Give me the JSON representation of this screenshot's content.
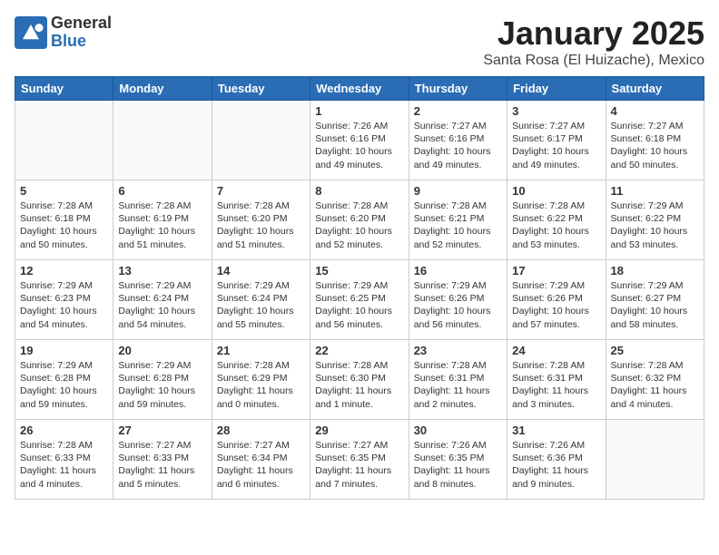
{
  "header": {
    "logo_general": "General",
    "logo_blue": "Blue",
    "month_title": "January 2025",
    "subtitle": "Santa Rosa (El Huizache), Mexico"
  },
  "days_of_week": [
    "Sunday",
    "Monday",
    "Tuesday",
    "Wednesday",
    "Thursday",
    "Friday",
    "Saturday"
  ],
  "weeks": [
    [
      {
        "day": "",
        "content": ""
      },
      {
        "day": "",
        "content": ""
      },
      {
        "day": "",
        "content": ""
      },
      {
        "day": "1",
        "content": "Sunrise: 7:26 AM\nSunset: 6:16 PM\nDaylight: 10 hours\nand 49 minutes."
      },
      {
        "day": "2",
        "content": "Sunrise: 7:27 AM\nSunset: 6:16 PM\nDaylight: 10 hours\nand 49 minutes."
      },
      {
        "day": "3",
        "content": "Sunrise: 7:27 AM\nSunset: 6:17 PM\nDaylight: 10 hours\nand 49 minutes."
      },
      {
        "day": "4",
        "content": "Sunrise: 7:27 AM\nSunset: 6:18 PM\nDaylight: 10 hours\nand 50 minutes."
      }
    ],
    [
      {
        "day": "5",
        "content": "Sunrise: 7:28 AM\nSunset: 6:18 PM\nDaylight: 10 hours\nand 50 minutes."
      },
      {
        "day": "6",
        "content": "Sunrise: 7:28 AM\nSunset: 6:19 PM\nDaylight: 10 hours\nand 51 minutes."
      },
      {
        "day": "7",
        "content": "Sunrise: 7:28 AM\nSunset: 6:20 PM\nDaylight: 10 hours\nand 51 minutes."
      },
      {
        "day": "8",
        "content": "Sunrise: 7:28 AM\nSunset: 6:20 PM\nDaylight: 10 hours\nand 52 minutes."
      },
      {
        "day": "9",
        "content": "Sunrise: 7:28 AM\nSunset: 6:21 PM\nDaylight: 10 hours\nand 52 minutes."
      },
      {
        "day": "10",
        "content": "Sunrise: 7:28 AM\nSunset: 6:22 PM\nDaylight: 10 hours\nand 53 minutes."
      },
      {
        "day": "11",
        "content": "Sunrise: 7:29 AM\nSunset: 6:22 PM\nDaylight: 10 hours\nand 53 minutes."
      }
    ],
    [
      {
        "day": "12",
        "content": "Sunrise: 7:29 AM\nSunset: 6:23 PM\nDaylight: 10 hours\nand 54 minutes."
      },
      {
        "day": "13",
        "content": "Sunrise: 7:29 AM\nSunset: 6:24 PM\nDaylight: 10 hours\nand 54 minutes."
      },
      {
        "day": "14",
        "content": "Sunrise: 7:29 AM\nSunset: 6:24 PM\nDaylight: 10 hours\nand 55 minutes."
      },
      {
        "day": "15",
        "content": "Sunrise: 7:29 AM\nSunset: 6:25 PM\nDaylight: 10 hours\nand 56 minutes."
      },
      {
        "day": "16",
        "content": "Sunrise: 7:29 AM\nSunset: 6:26 PM\nDaylight: 10 hours\nand 56 minutes."
      },
      {
        "day": "17",
        "content": "Sunrise: 7:29 AM\nSunset: 6:26 PM\nDaylight: 10 hours\nand 57 minutes."
      },
      {
        "day": "18",
        "content": "Sunrise: 7:29 AM\nSunset: 6:27 PM\nDaylight: 10 hours\nand 58 minutes."
      }
    ],
    [
      {
        "day": "19",
        "content": "Sunrise: 7:29 AM\nSunset: 6:28 PM\nDaylight: 10 hours\nand 59 minutes."
      },
      {
        "day": "20",
        "content": "Sunrise: 7:29 AM\nSunset: 6:28 PM\nDaylight: 10 hours\nand 59 minutes."
      },
      {
        "day": "21",
        "content": "Sunrise: 7:28 AM\nSunset: 6:29 PM\nDaylight: 11 hours\nand 0 minutes."
      },
      {
        "day": "22",
        "content": "Sunrise: 7:28 AM\nSunset: 6:30 PM\nDaylight: 11 hours\nand 1 minute."
      },
      {
        "day": "23",
        "content": "Sunrise: 7:28 AM\nSunset: 6:31 PM\nDaylight: 11 hours\nand 2 minutes."
      },
      {
        "day": "24",
        "content": "Sunrise: 7:28 AM\nSunset: 6:31 PM\nDaylight: 11 hours\nand 3 minutes."
      },
      {
        "day": "25",
        "content": "Sunrise: 7:28 AM\nSunset: 6:32 PM\nDaylight: 11 hours\nand 4 minutes."
      }
    ],
    [
      {
        "day": "26",
        "content": "Sunrise: 7:28 AM\nSunset: 6:33 PM\nDaylight: 11 hours\nand 4 minutes."
      },
      {
        "day": "27",
        "content": "Sunrise: 7:27 AM\nSunset: 6:33 PM\nDaylight: 11 hours\nand 5 minutes."
      },
      {
        "day": "28",
        "content": "Sunrise: 7:27 AM\nSunset: 6:34 PM\nDaylight: 11 hours\nand 6 minutes."
      },
      {
        "day": "29",
        "content": "Sunrise: 7:27 AM\nSunset: 6:35 PM\nDaylight: 11 hours\nand 7 minutes."
      },
      {
        "day": "30",
        "content": "Sunrise: 7:26 AM\nSunset: 6:35 PM\nDaylight: 11 hours\nand 8 minutes."
      },
      {
        "day": "31",
        "content": "Sunrise: 7:26 AM\nSunset: 6:36 PM\nDaylight: 11 hours\nand 9 minutes."
      },
      {
        "day": "",
        "content": ""
      }
    ]
  ]
}
